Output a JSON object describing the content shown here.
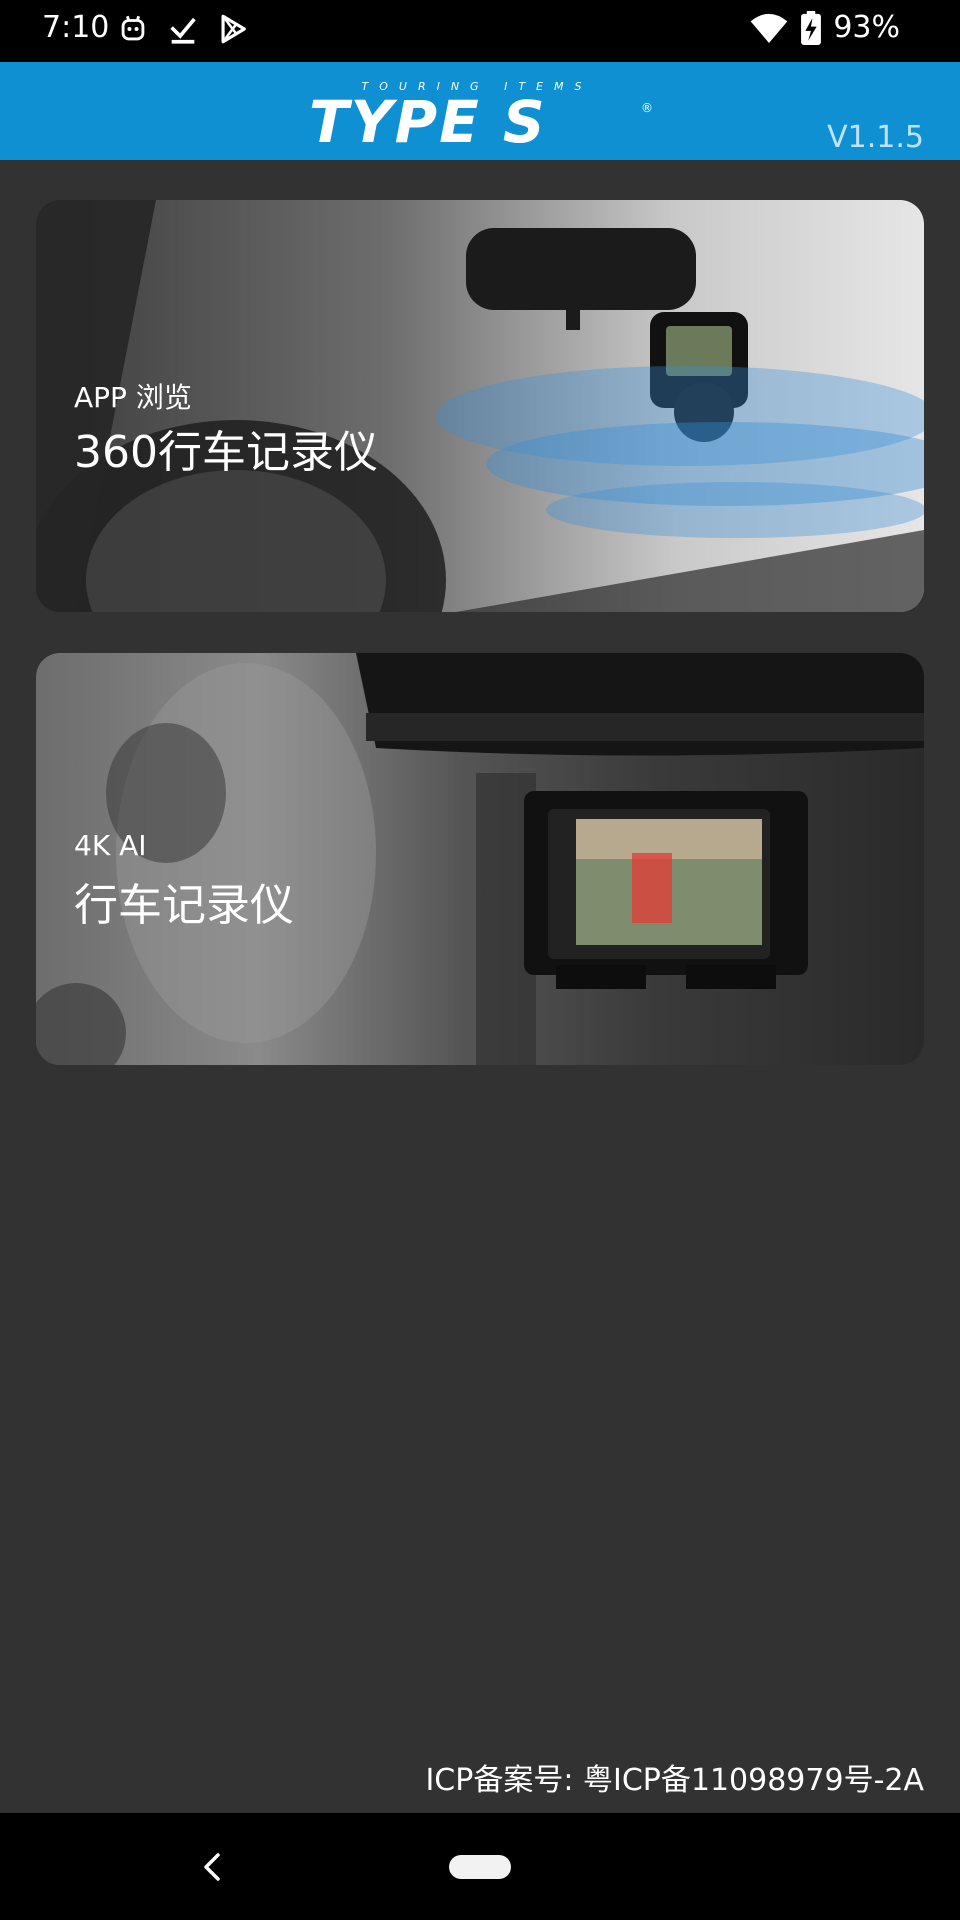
{
  "status_bar": {
    "time": "7:10",
    "battery": "93%",
    "icons_left": [
      "robot-icon",
      "checkmark-download-icon",
      "play-store-icon"
    ],
    "icons_right": [
      "wifi-icon",
      "battery-charging-icon"
    ]
  },
  "header": {
    "tagline": "TOURING ITEMS",
    "logo": "TYPE S",
    "registered": "®",
    "version": "V1.1.5",
    "color": "#0f90d2"
  },
  "cards": [
    {
      "subtitle": "APP 浏览",
      "title": "360行车记录仪"
    },
    {
      "subtitle": "4K AI",
      "title": "行车记录仪"
    }
  ],
  "footer": {
    "icp": "ICP备案号: 粤ICP备11098979号-2A"
  },
  "nav": {
    "back": "back-icon",
    "home": "home-pill"
  }
}
